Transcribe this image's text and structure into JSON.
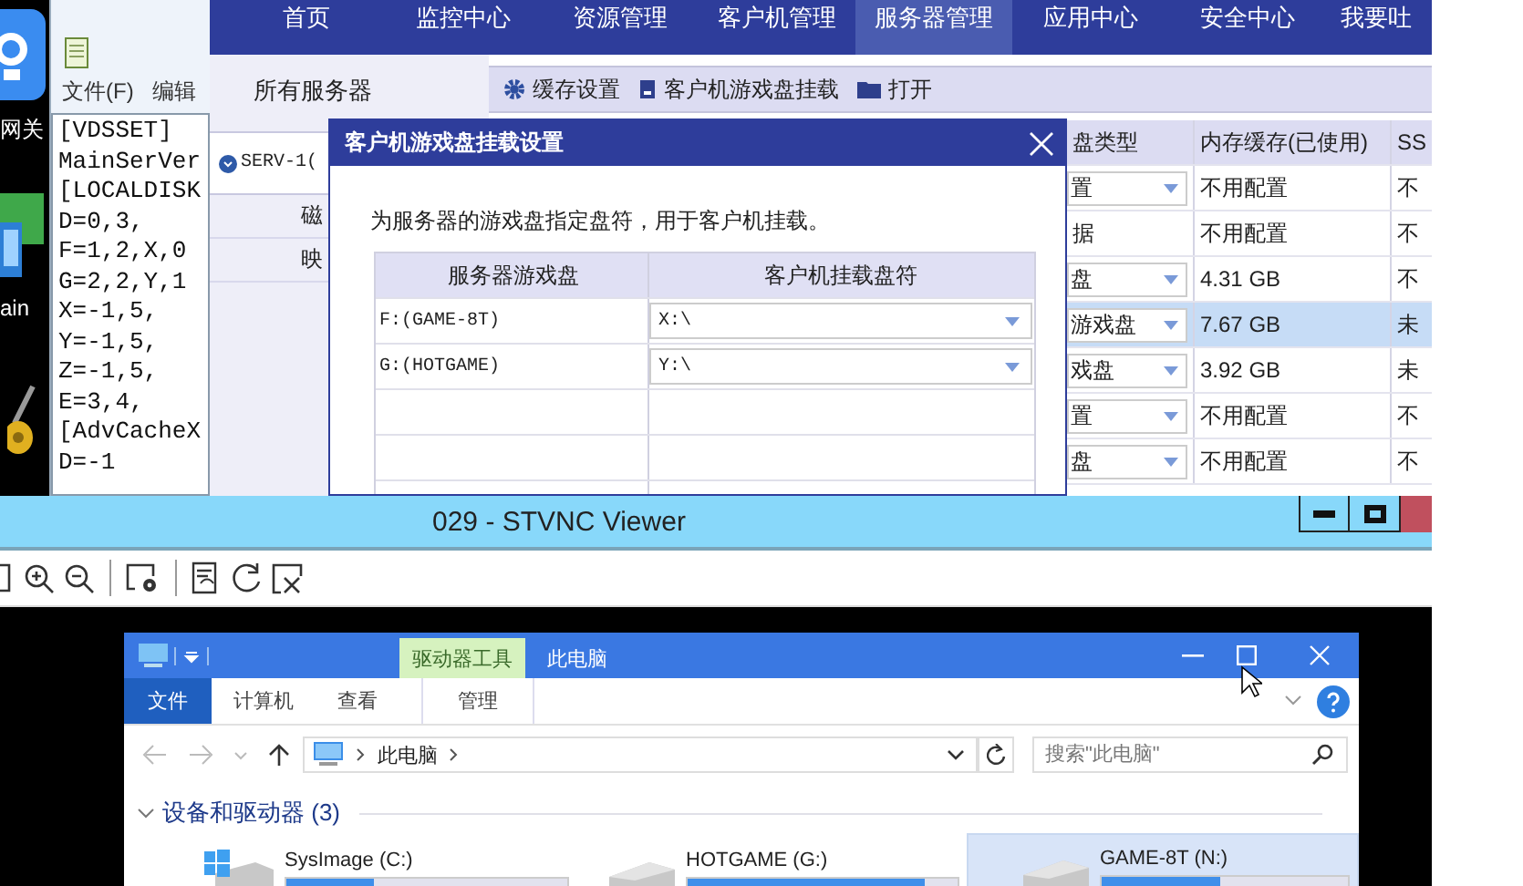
{
  "desktop_icons": [
    {
      "kind": "app",
      "label": "网关"
    },
    {
      "kind": "monitor",
      "label": "ain"
    },
    {
      "kind": "tool"
    }
  ],
  "notepad": {
    "menu": [
      "文件(F)",
      "编辑"
    ],
    "lines": [
      "[VDSSET]",
      "MainSerVer",
      "[LOCALDISK",
      "D=0,3,",
      "F=1,2,X,0",
      "G=2,2,Y,1",
      "X=-1,5,",
      "Y=-1,5,",
      "Z=-1,5,",
      "E=3,4,",
      "[AdvCacheX",
      "D=-1"
    ]
  },
  "app": {
    "nav": [
      {
        "label": "首页",
        "selected": false
      },
      {
        "label": "监控中心",
        "selected": false
      },
      {
        "label": "资源管理",
        "selected": false
      },
      {
        "label": "客户机管理",
        "selected": false
      },
      {
        "label": "服务器管理",
        "selected": true
      },
      {
        "label": "应用中心",
        "selected": false
      },
      {
        "label": "安全中心",
        "selected": false
      },
      {
        "label": "我要吐",
        "selected": false
      }
    ],
    "sidebar": {
      "title": "所有服务器",
      "servers": [
        {
          "label": "SERV-1(",
          "selected": true
        }
      ],
      "items": [
        "磁",
        "映"
      ]
    },
    "toolbar": [
      {
        "kind": "gear",
        "label": "缓存设置"
      },
      {
        "kind": "disk",
        "label": "客户机游戏盘挂载"
      },
      {
        "kind": "folder",
        "label": "打开"
      }
    ],
    "table": {
      "columns": [
        "盘类型",
        "内存缓存(已使用)",
        "SS"
      ],
      "rows": [
        {
          "kind": "dropdown",
          "cells": [
            "置",
            "不用配置",
            "不"
          ],
          "selected": false
        },
        {
          "kind": "text",
          "cells": [
            "据",
            "不用配置",
            "不"
          ],
          "selected": false
        },
        {
          "kind": "dropdown",
          "cells": [
            "盘",
            "4.31 GB",
            "不"
          ],
          "selected": false
        },
        {
          "kind": "dropdown",
          "cells": [
            "游戏盘",
            "7.67 GB",
            "未"
          ],
          "selected": true
        },
        {
          "kind": "dropdown",
          "cells": [
            "戏盘",
            "3.92 GB",
            "未"
          ],
          "selected": false
        },
        {
          "kind": "dropdown",
          "cells": [
            "置",
            "不用配置",
            "不"
          ],
          "selected": false
        },
        {
          "kind": "dropdown",
          "cells": [
            "盘",
            "不用配置",
            "不"
          ],
          "selected": false
        }
      ]
    }
  },
  "dialog": {
    "title": "客户机游戏盘挂载设置",
    "instruction": "为服务器的游戏盘指定盘符，用于客户机挂载。",
    "columns": [
      "服务器游戏盘",
      "客户机挂载盘符"
    ],
    "rows": [
      {
        "disk": "F:(GAME-8T)",
        "letter": "X:\\"
      },
      {
        "disk": "G:(HOTGAME)",
        "letter": "Y:\\"
      }
    ]
  },
  "vnc": {
    "title": "029 - STVNC Viewer"
  },
  "explorer": {
    "context_tab": "驱动器工具",
    "title": "此电脑",
    "ribbon_tabs": [
      {
        "label": "文件",
        "selected": true
      },
      {
        "label": "计算机",
        "selected": false
      },
      {
        "label": "查看",
        "selected": false
      },
      {
        "label": "管理",
        "selected": false
      }
    ],
    "breadcrumb": "此电脑",
    "search": {
      "placeholder": "搜索\"此电脑\""
    },
    "group": "设备和驱动器 (3)",
    "drives": [
      {
        "kind": "system",
        "name": "SysImage (C:)",
        "level": 0.31,
        "selected": false
      },
      {
        "kind": "disk",
        "name": "HOTGAME (G:)",
        "level": 0.88,
        "selected": false
      },
      {
        "kind": "disk",
        "name": "GAME-8T (N:)",
        "level": 0.48,
        "selected": true
      }
    ]
  }
}
